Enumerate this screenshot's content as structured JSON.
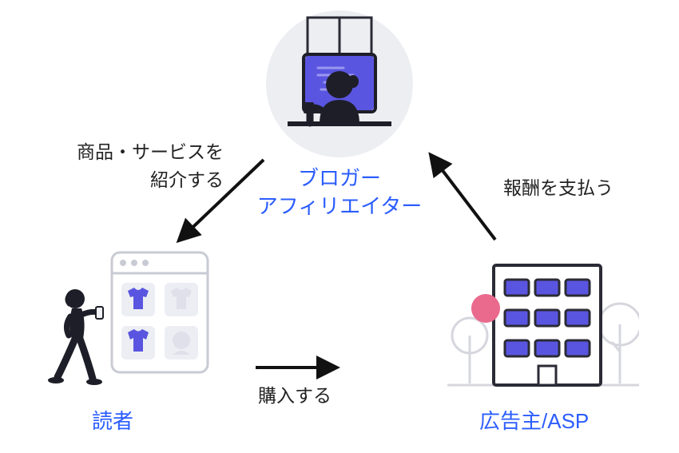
{
  "nodes": {
    "top": {
      "label_line1": "ブロガー",
      "label_line2": "アフィリエイター"
    },
    "left": {
      "label": "読者"
    },
    "right": {
      "label": "広告主/ASP"
    }
  },
  "edges": {
    "top_to_left": {
      "label_line1": "商品・サービスを",
      "label_line2": "紹介する"
    },
    "left_to_right": {
      "label": "購入する"
    },
    "right_to_top": {
      "label": "報酬を支払う"
    }
  },
  "colors": {
    "accent_blue": "#2b5dff",
    "illus_purple": "#5a55e0",
    "illus_dark": "#1e1e28",
    "illus_pink": "#e96a8d",
    "illus_grey": "#dcdde3"
  }
}
